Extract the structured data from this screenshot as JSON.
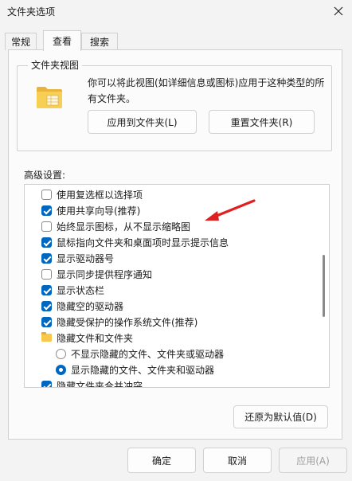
{
  "window": {
    "title": "文件夹选项"
  },
  "tabs": [
    {
      "label": "常规"
    },
    {
      "label": "查看"
    },
    {
      "label": "搜索"
    }
  ],
  "folder_views": {
    "group_title": "文件夹视图",
    "description": "你可以将此视图(如详细信息或图标)应用于这种类型的所有文件夹。",
    "apply_button": "应用到文件夹(L)",
    "reset_button": "重置文件夹(R)"
  },
  "advanced": {
    "label": "高级设置:",
    "items": [
      {
        "type": "checkbox",
        "label": "使用复选框以选择项",
        "checked": false
      },
      {
        "type": "checkbox",
        "label": "使用共享向导(推荐)",
        "checked": true
      },
      {
        "type": "checkbox",
        "label": "始终显示图标，从不显示缩略图",
        "checked": false
      },
      {
        "type": "checkbox",
        "label": "鼠标指向文件夹和桌面项时显示提示信息",
        "checked": true
      },
      {
        "type": "checkbox",
        "label": "显示驱动器号",
        "checked": true
      },
      {
        "type": "checkbox",
        "label": "显示同步提供程序通知",
        "checked": false
      },
      {
        "type": "checkbox",
        "label": "显示状态栏",
        "checked": true
      },
      {
        "type": "checkbox",
        "label": "隐藏空的驱动器",
        "checked": true
      },
      {
        "type": "checkbox",
        "label": "隐藏受保护的操作系统文件(推荐)",
        "checked": true
      },
      {
        "type": "folder",
        "label": "隐藏文件和文件夹"
      },
      {
        "type": "radio",
        "label": "不显示隐藏的文件、文件夹或驱动器",
        "checked": false
      },
      {
        "type": "radio",
        "label": "显示隐藏的文件、文件夹和驱动器",
        "checked": true
      },
      {
        "type": "checkbox",
        "label": "隐藏文件夹合并冲突",
        "checked": true
      }
    ],
    "restore_button": "还原为默认值(D)"
  },
  "footer": {
    "ok": "确定",
    "cancel": "取消",
    "apply": "应用(A)"
  },
  "colors": {
    "accent": "#0067c0",
    "annotation_arrow": "#e02020"
  }
}
